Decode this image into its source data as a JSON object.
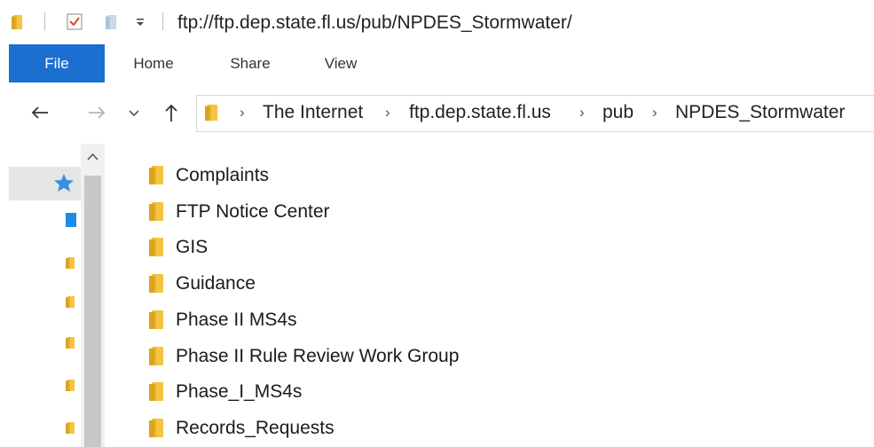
{
  "window": {
    "title": "ftp://ftp.dep.state.fl.us/pub/NPDES_Stormwater/"
  },
  "ribbon": {
    "tabs": [
      "File",
      "Home",
      "Share",
      "View"
    ]
  },
  "address": {
    "breadcrumbs": [
      "The Internet",
      "ftp.dep.state.fl.us",
      "pub",
      "NPDES_Stormwater"
    ]
  },
  "folders": [
    "Complaints",
    "FTP Notice Center",
    "GIS",
    "Guidance",
    "Phase II MS4s",
    "Phase II Rule Review Work Group",
    "Phase_I_MS4s",
    "Records_Requests"
  ],
  "icons": {
    "folder": "folder-icon",
    "quick_access": "star-icon",
    "desktop": "desktop-icon"
  },
  "colors": {
    "file_tab": "#1a6fd0",
    "folder_yellow": "#f5c542",
    "folder_dark": "#dba41e",
    "star_blue": "#3b8fe0"
  }
}
